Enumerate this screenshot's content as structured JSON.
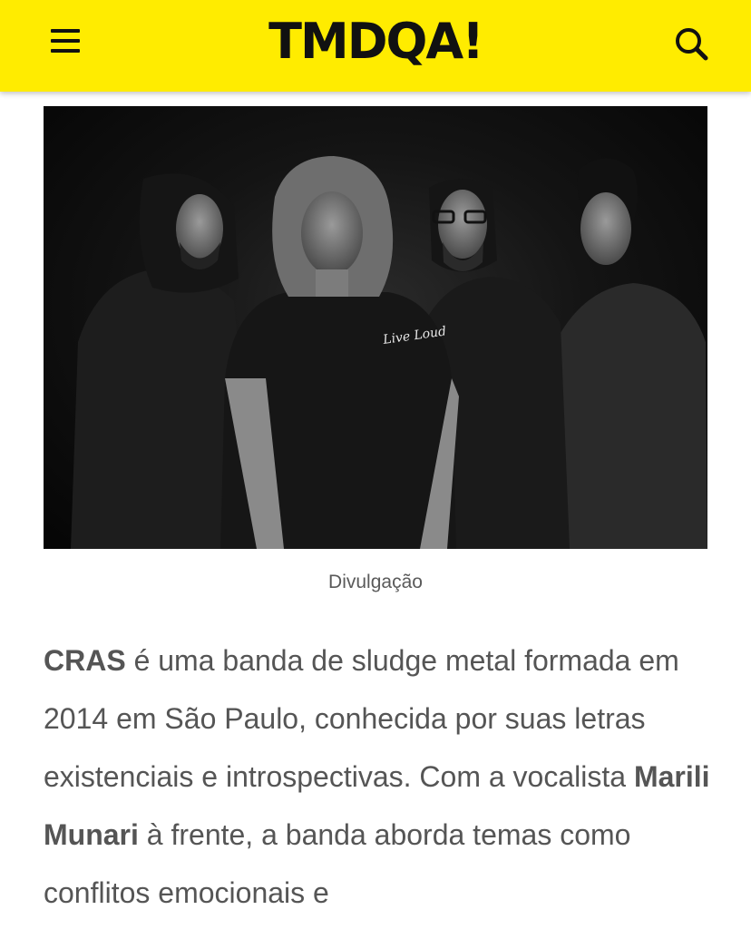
{
  "header": {
    "logo_text": "TMDQA!",
    "background_color": "#ffec00",
    "menu_icon": "hamburger-menu-icon",
    "search_icon": "search-icon"
  },
  "hero_image": {
    "caption": "Divulgação",
    "shirt_print": "Live Loud"
  },
  "article": {
    "p1_band": "CRAS",
    "p1_text_a": " é uma banda de sludge metal formada em 2014 em São Paulo, conhecida por suas letras existenciais e introspectivas. Com a vocalista ",
    "p1_vocalist": "Marili Munari",
    "p1_text_b": " à frente, a banda aborda temas como conflitos emocionais e"
  }
}
